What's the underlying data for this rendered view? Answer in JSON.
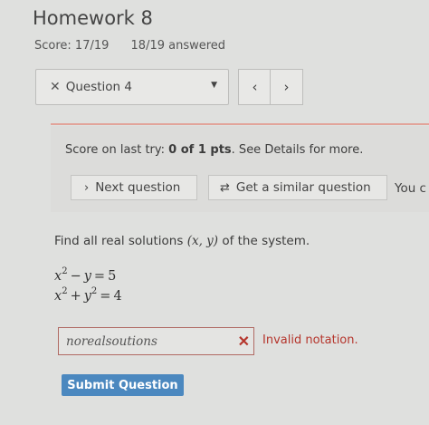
{
  "header": {
    "title": "Homework 8",
    "score": "Score: 17/19",
    "answered": "18/19 answered"
  },
  "question_nav": {
    "status_icon": "x-icon",
    "selected": "Question 4",
    "prev_label": "‹",
    "next_label": "›"
  },
  "notice": {
    "prefix": "Score on last try: ",
    "score": "0 of 1 pts",
    "suffix": ". See Details for more.",
    "next_question": "Next question",
    "similar_question": "Get a similar question",
    "you_can": "You c"
  },
  "question": {
    "prompt_before": "Find all real solutions ",
    "prompt_math": "(x, y)",
    "prompt_after": " of the system.",
    "eq1": {
      "a": "x",
      "ae": "2",
      "op": "−",
      "b": "y",
      "eq": "=",
      "rhs": "5"
    },
    "eq2": {
      "a": "x",
      "ae": "2",
      "op": "+",
      "b": "y",
      "be": "2",
      "eq": "=",
      "rhs": "4"
    }
  },
  "answer": {
    "value": "norealsoutions",
    "error": "Invalid notation."
  },
  "submit_label": "Submit Question",
  "colors": {
    "error": "#b5352c",
    "submit": "#4b88bf",
    "divider": "#e2a49a"
  }
}
